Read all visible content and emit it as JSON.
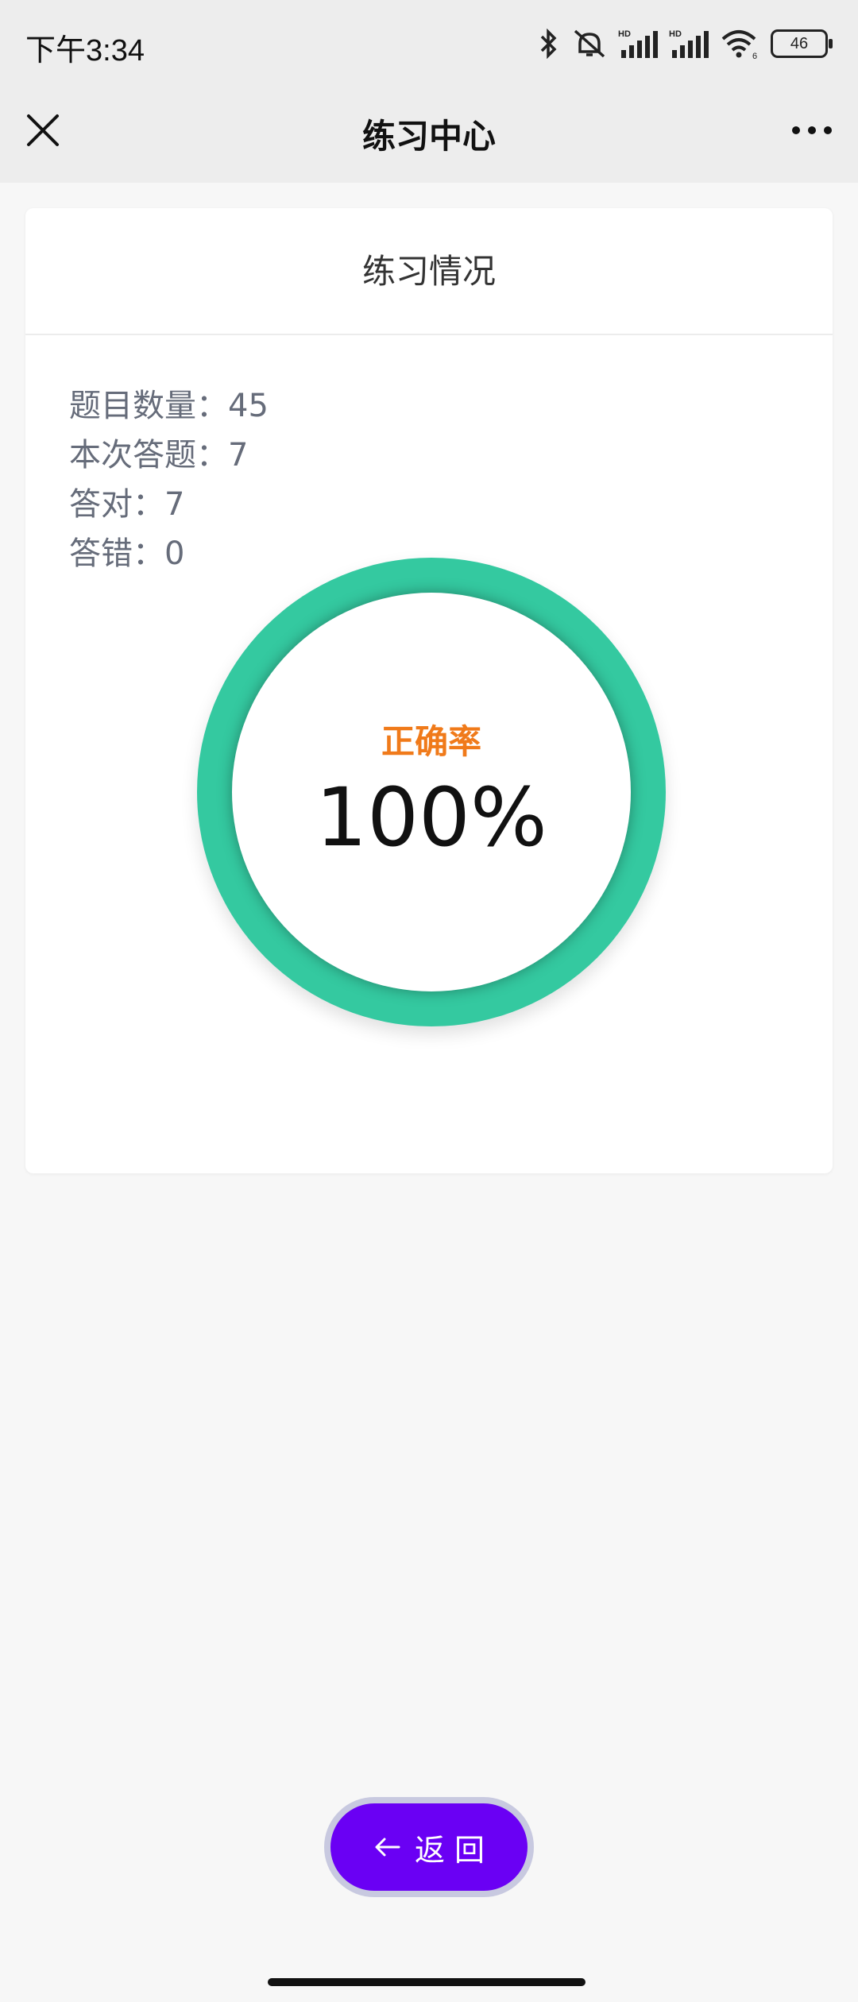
{
  "status_bar": {
    "time": "下午3:34",
    "battery": "46"
  },
  "nav": {
    "title": "练习中心",
    "close_icon": "close-icon",
    "more_icon": "more-icon"
  },
  "card": {
    "header": "练习情况",
    "stats": [
      {
        "label": "题目数量：",
        "value": "45"
      },
      {
        "label": "本次答题：",
        "value": "7"
      },
      {
        "label": "答对：",
        "value": "7"
      },
      {
        "label": "答错：",
        "value": "0"
      }
    ],
    "accuracy": {
      "label": "正确率",
      "value": "100%",
      "fraction": 1.0
    }
  },
  "back_button": {
    "label": "返 回",
    "icon": "arrow-left-icon"
  },
  "colors": {
    "ring": "#34c9a0",
    "accuracy_label": "#f07a1a",
    "button": "#6a00f4"
  }
}
